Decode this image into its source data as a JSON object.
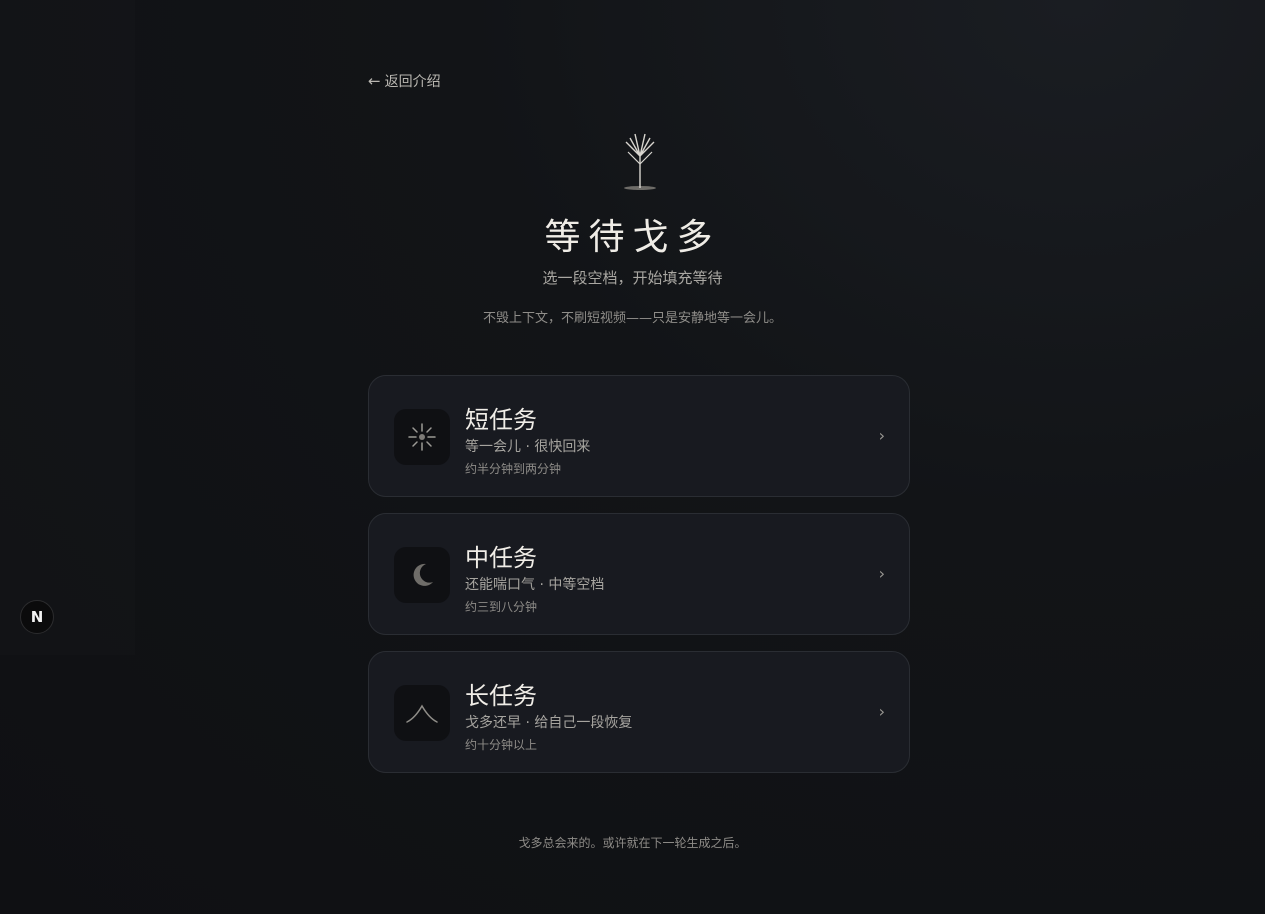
{
  "back": {
    "arrow": "←",
    "label": "返回介绍"
  },
  "hero": {
    "icon": "wheat-sprout-icon",
    "title": "等待戈多",
    "subtitle": "选一段空档，开始填充等待",
    "description": "不毁上下文，不刷短视频——只是安静地等一会儿。"
  },
  "cards": [
    {
      "icon": "sun-sparkle-icon",
      "title": "短任务",
      "subtitle": "等一会儿 · 很快回来",
      "time": "约半分钟到两分钟",
      "chevron": "›"
    },
    {
      "icon": "crescent-moon-icon",
      "title": "中任务",
      "subtitle": "还能喘口气 · 中等空档",
      "time": "约三到八分钟",
      "chevron": "›"
    },
    {
      "icon": "mountain-peak-icon",
      "title": "长任务",
      "subtitle": "戈多还早 · 给自己一段恢复",
      "time": "约十分钟以上",
      "chevron": "›"
    }
  ],
  "footer": {
    "text": "戈多总会来的。或许就在下一轮生成之后。"
  },
  "badge": {
    "label": "N",
    "icon": "nextjs-logo-icon"
  }
}
